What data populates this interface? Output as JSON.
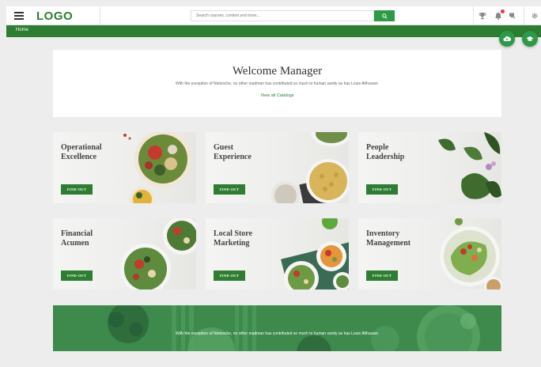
{
  "header": {
    "logo": "LOGO",
    "search_placeholder": "Search courses, content and more..."
  },
  "breadcrumb": {
    "home": "Home"
  },
  "welcome": {
    "title": "Welcome Manager",
    "subtitle": "With the exception of Nietzsche, no other madman has contributed so much to human sanity as has Louis Althusser.",
    "link": "View all Catalogs"
  },
  "cards": [
    {
      "line1": "Operational",
      "line2": "Excellence",
      "button": "FIND OUT"
    },
    {
      "line1": "Guest",
      "line2": "Experience",
      "button": "FIND OUT"
    },
    {
      "line1": "People",
      "line2": "Leadership",
      "button": "FIND OUT"
    },
    {
      "line1": "Financial",
      "line2": "Acumen",
      "button": "FIND OUT"
    },
    {
      "line1": "Local Store",
      "line2": "Marketing",
      "button": "FIND OUT"
    },
    {
      "line1": "Inventory",
      "line2": "Management",
      "button": "FIND OUT"
    }
  ],
  "banner": {
    "text": "With the exception of Nietzsche, no other madman has contributed so much to human sanity as has Louis Althusser."
  },
  "icons": {
    "menu": "hamburger-icon",
    "search": "search-icon",
    "trophy": "trophy-icon",
    "notifications": "bell-icon",
    "chat": "chat-icon",
    "settings": "gear-icon",
    "cloud": "cloud-upload-icon",
    "graduation": "graduation-cap-icon"
  },
  "colors": {
    "brand_green": "#2e7d32",
    "accent_green": "#2e9a48",
    "notification_red": "#e53935"
  }
}
